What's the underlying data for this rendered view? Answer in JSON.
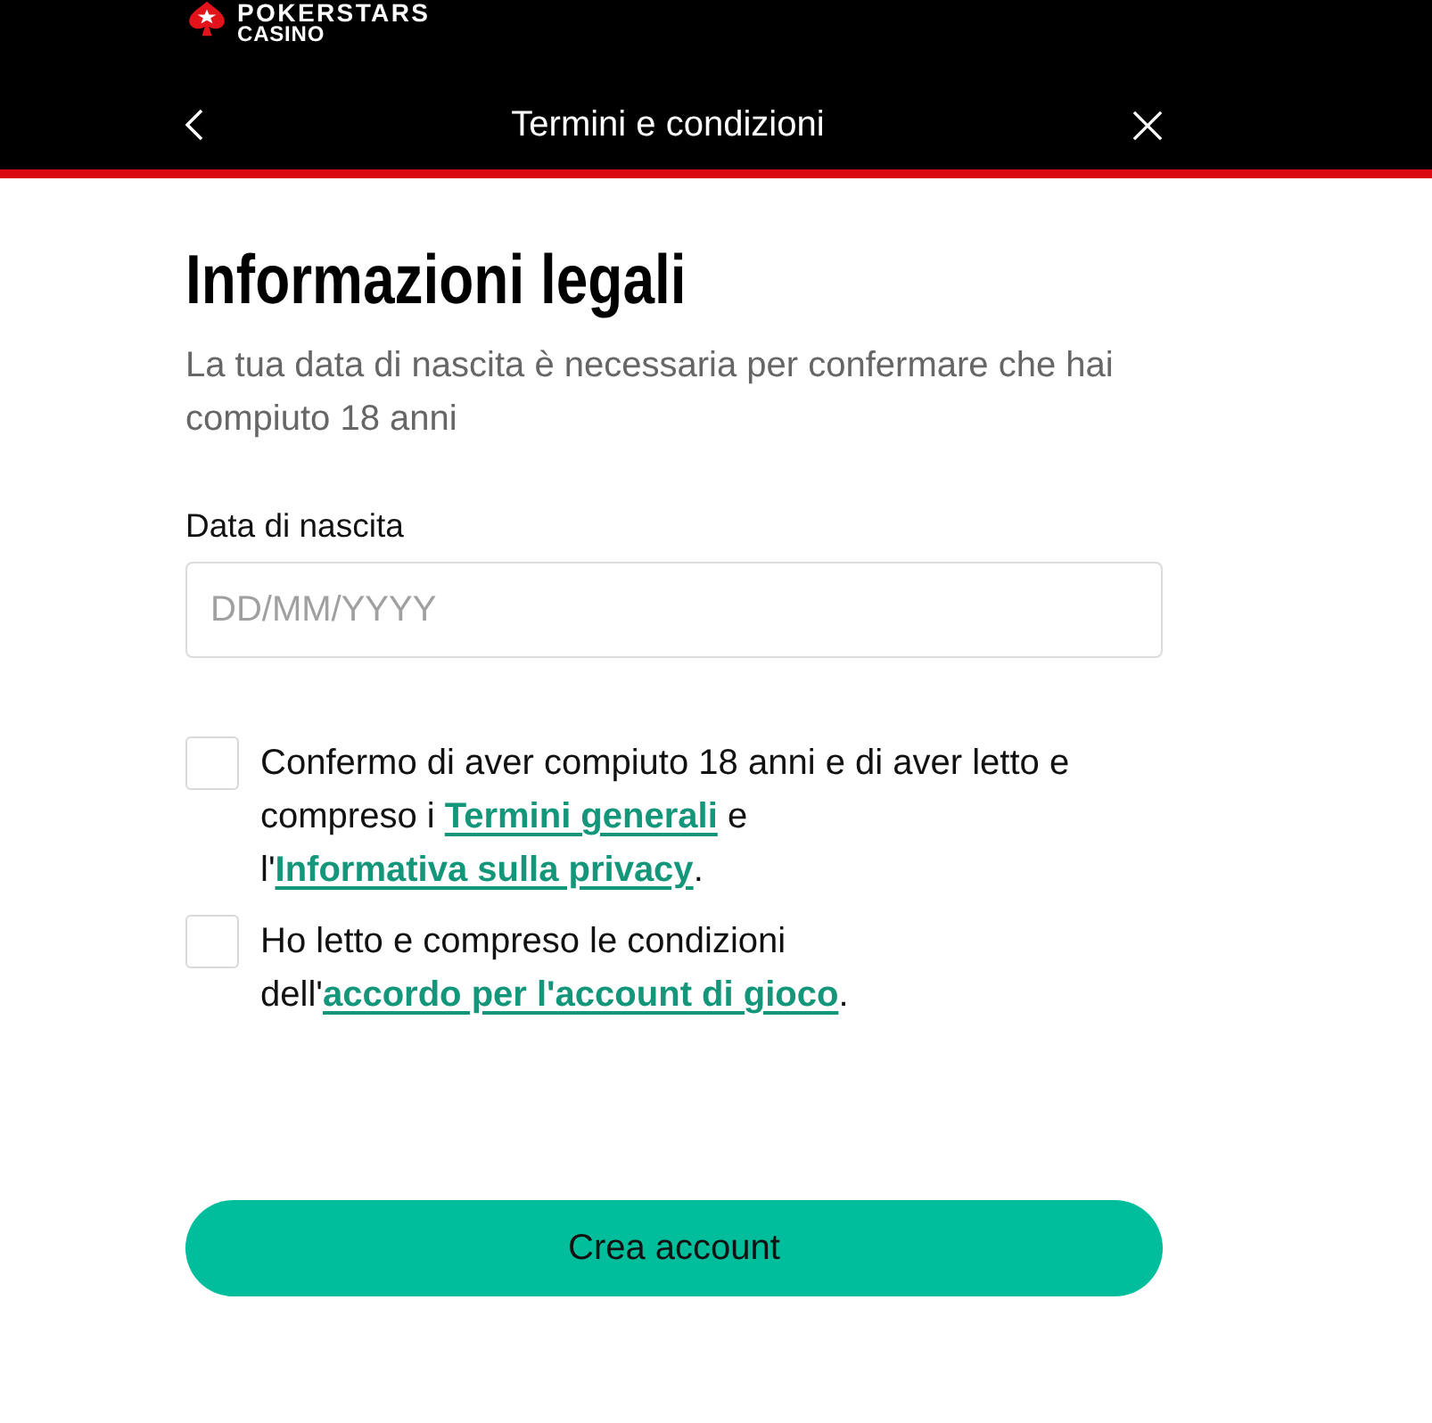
{
  "header": {
    "logo": {
      "brand": "POKERSTARS",
      "product": "CASINO"
    },
    "title": "Termini e condizioni"
  },
  "heading": "Informazioni legali",
  "intro": "La tua data di nascita è necessaria per confermare che hai compiuto 18 anni",
  "birthdate": {
    "label": "Data di nascita",
    "placeholder": "DD/MM/YYYY"
  },
  "consents": [
    {
      "checked": false,
      "parts": [
        {
          "kind": "text",
          "text": "Confermo di aver compiuto 18 anni e di aver letto e compreso i "
        },
        {
          "kind": "link",
          "text": "Termini generali"
        },
        {
          "kind": "text",
          "text": " e l'"
        },
        {
          "kind": "link",
          "text": "Informativa sulla privacy"
        },
        {
          "kind": "text",
          "text": "."
        }
      ]
    },
    {
      "checked": false,
      "parts": [
        {
          "kind": "text",
          "text": "Ho letto e compreso le condizioni dell'"
        },
        {
          "kind": "link",
          "text": "accordo per l'account di gioco"
        },
        {
          "kind": "text",
          "text": "."
        }
      ]
    }
  ],
  "submit_button": "Crea account"
}
